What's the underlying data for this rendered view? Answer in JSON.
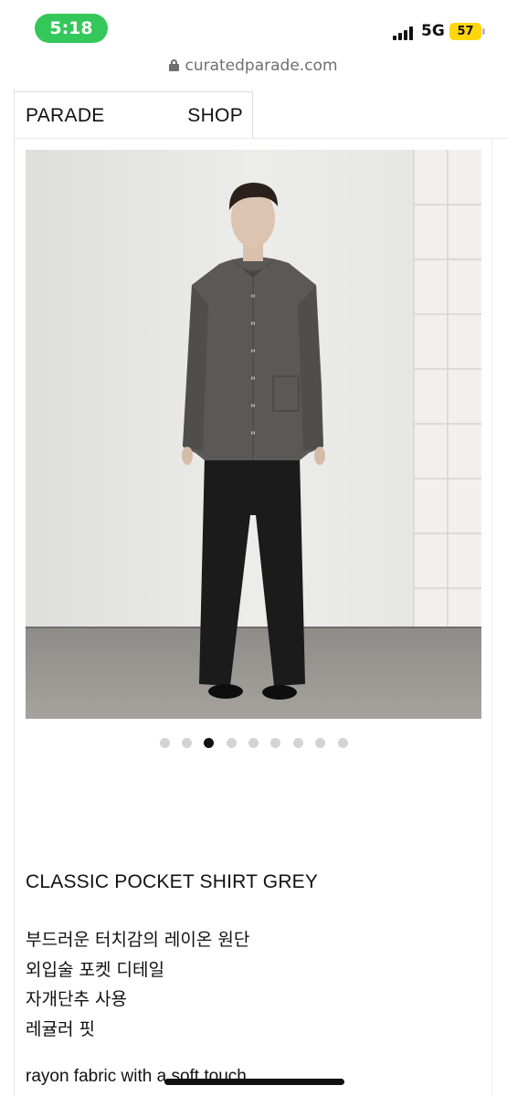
{
  "status_bar": {
    "time": "5:18",
    "network": "5G",
    "battery": "57"
  },
  "browser": {
    "url": "curatedparade.com"
  },
  "nav": {
    "brand": "PARADE",
    "shop": "SHOP"
  },
  "gallery": {
    "dot_count": 9,
    "active_index": 2
  },
  "product": {
    "title": "CLASSIC POCKET SHIRT GREY",
    "description_kr": [
      "부드러운 터치감의 레이온 원단",
      "외입술 포켓 디테일",
      "자개단추 사용",
      "레귤러 핏"
    ],
    "description_en": "rayon fabric with a soft touch"
  },
  "colors": {
    "time_pill": "#34c759",
    "battery": "#ffd60a",
    "active_dot": "#111111",
    "inactive_dot": "#d3d3d3"
  }
}
